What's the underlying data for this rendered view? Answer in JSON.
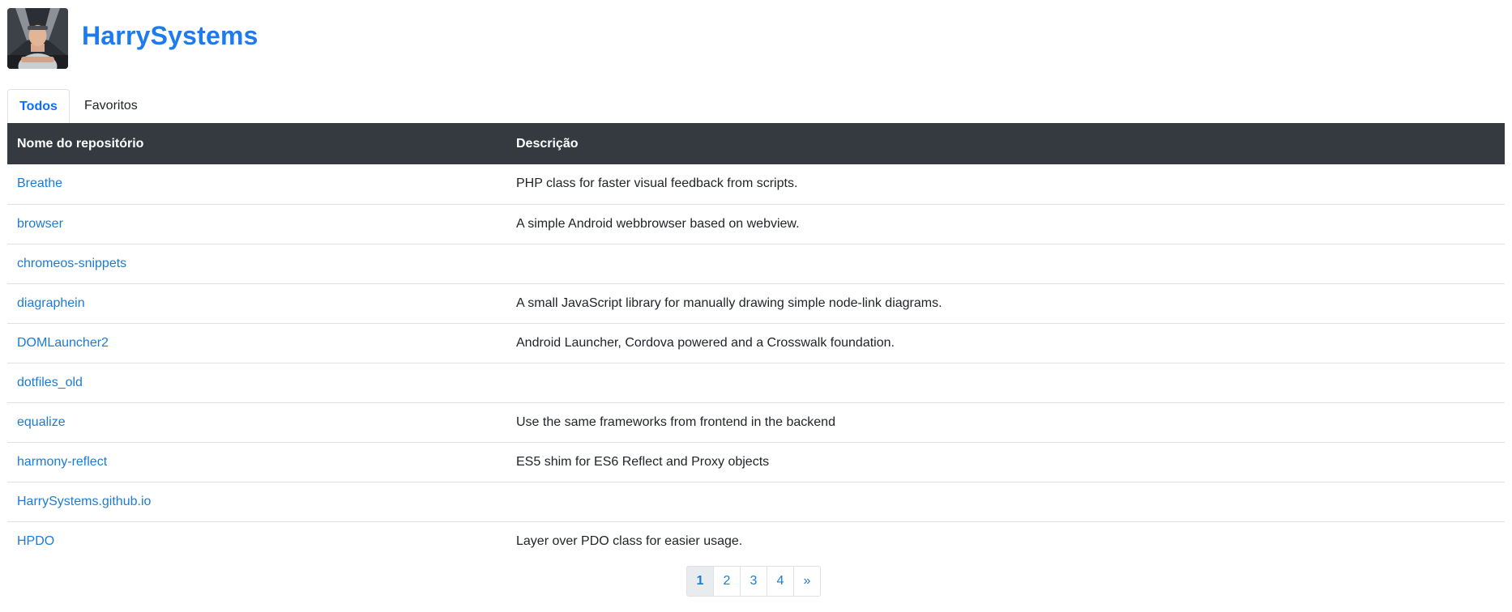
{
  "brand": {
    "title": "HarrySystems"
  },
  "tabs": [
    {
      "label": "Todos",
      "active": true
    },
    {
      "label": "Favoritos",
      "active": false
    }
  ],
  "table": {
    "headers": {
      "name": "Nome do repositório",
      "description": "Descrição"
    },
    "rows": [
      {
        "name": "Breathe",
        "description": "PHP class for faster visual feedback from scripts."
      },
      {
        "name": "browser",
        "description": "A simple Android webbrowser based on webview."
      },
      {
        "name": "chromeos-snippets",
        "description": ""
      },
      {
        "name": "diagraphein",
        "description": "A small JavaScript library for manually drawing simple node-link diagrams."
      },
      {
        "name": "DOMLauncher2",
        "description": "Android Launcher, Cordova powered and a Crosswalk foundation."
      },
      {
        "name": "dotfiles_old",
        "description": ""
      },
      {
        "name": "equalize",
        "description": "Use the same frameworks from frontend in the backend"
      },
      {
        "name": "harmony-reflect",
        "description": "ES5 shim for ES6 Reflect and Proxy objects"
      },
      {
        "name": "HarrySystems.github.io",
        "description": ""
      },
      {
        "name": "HPDO",
        "description": "Layer over PDO class for easier usage."
      }
    ]
  },
  "pagination": {
    "pages": [
      "1",
      "2",
      "3",
      "4"
    ],
    "current": "1",
    "next_label": "»"
  },
  "colors": {
    "brand": "#1d7bf0",
    "link": "#1d7bd3",
    "table_header_bg": "#343a40"
  }
}
